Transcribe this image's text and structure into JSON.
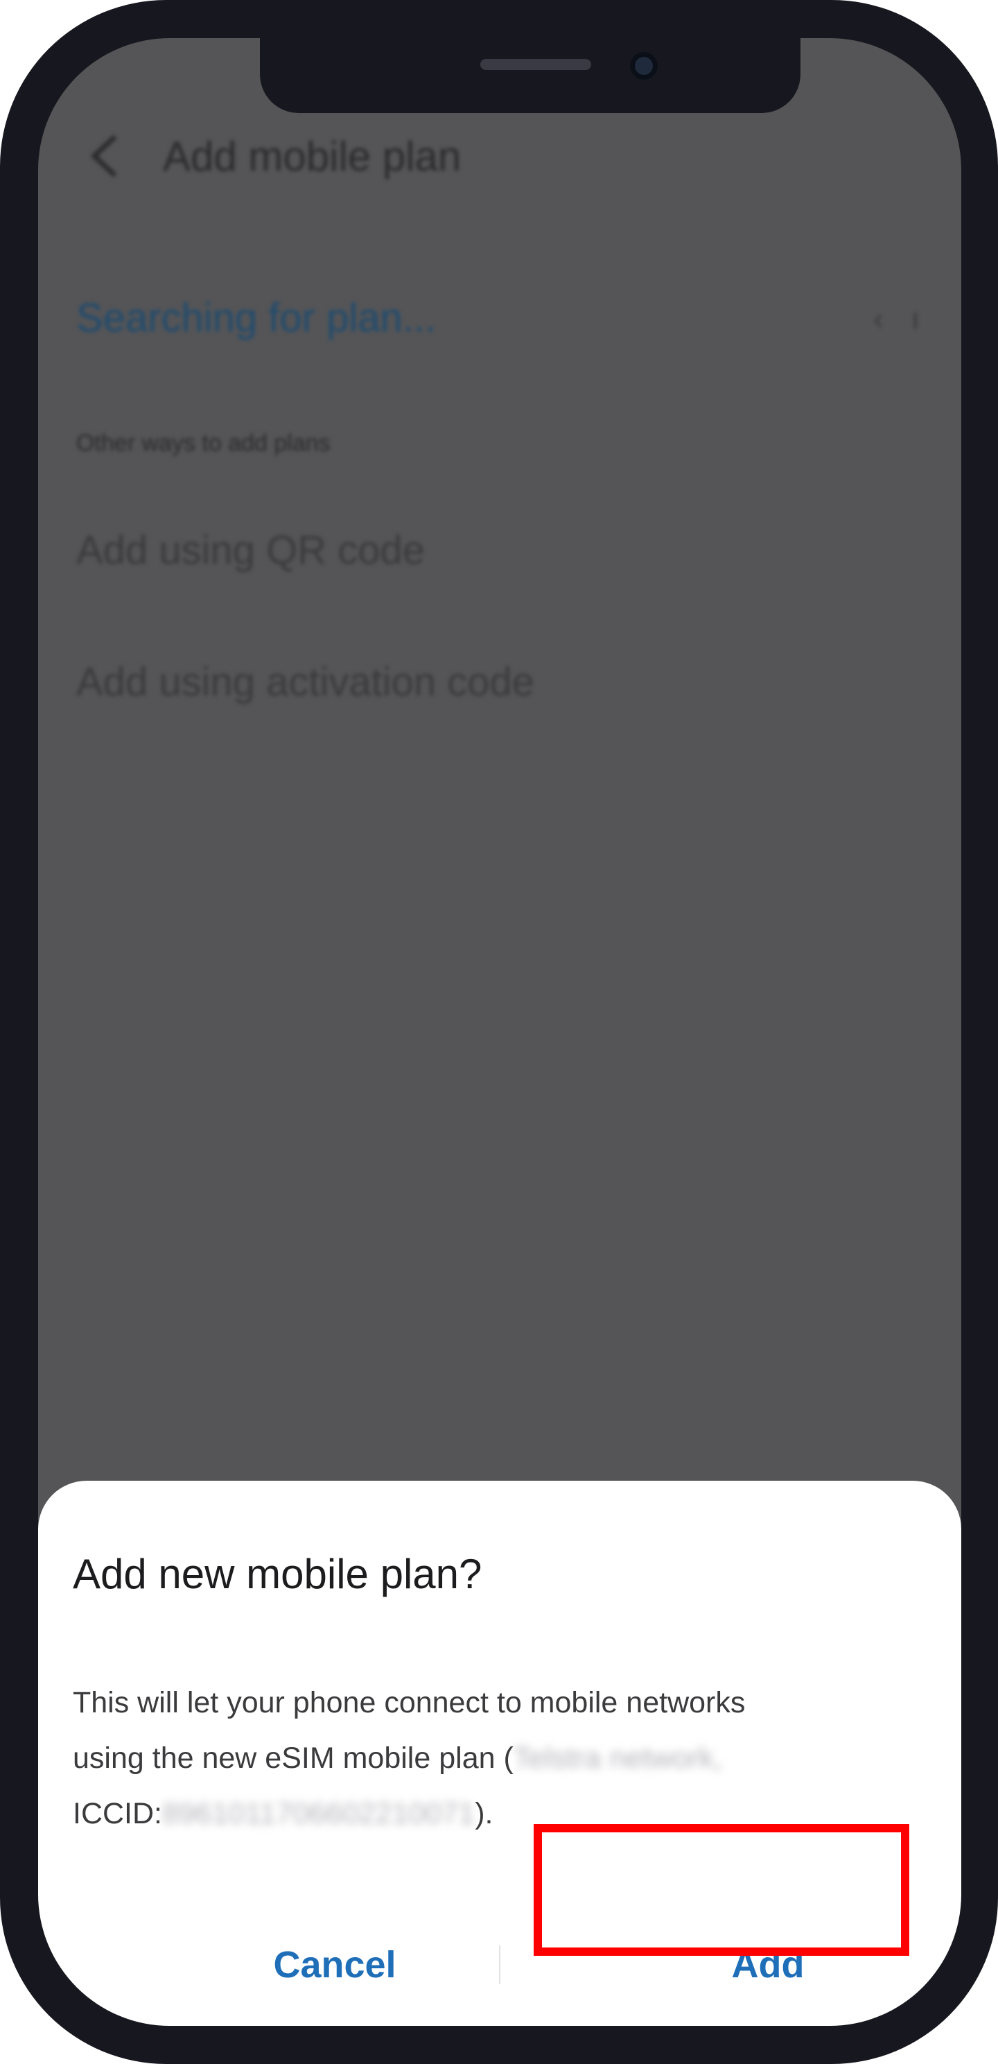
{
  "header": {
    "back_icon": "chevron-left-icon",
    "title": "Add mobile plan"
  },
  "content": {
    "searching_label": "Searching for plan...",
    "section_label": "Other ways to add plans",
    "options": [
      "Add using QR code",
      "Add using activation code"
    ]
  },
  "dialog": {
    "title": "Add new mobile plan?",
    "body_line1": "This will let your phone connect to mobile networks",
    "body_line2_prefix": "using the new eSIM mobile plan (",
    "network_redacted": "Telstra network,",
    "body_line3_prefix": "ICCID:",
    "iccid_redacted": "8961011706602210071",
    "body_suffix": ").",
    "cancel_label": "Cancel",
    "add_label": "Add"
  },
  "colors": {
    "accent": "#1e6eb8",
    "highlight": "#ff0000",
    "overlay": "#555557",
    "frame": "#17171f"
  }
}
